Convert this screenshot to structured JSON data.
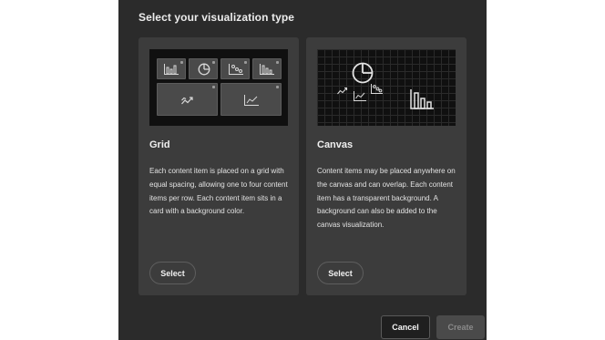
{
  "dialog": {
    "title": "Select your visualization type",
    "cancel_label": "Cancel",
    "create_label": "Create",
    "create_enabled": false
  },
  "cards": {
    "grid": {
      "title": "Grid",
      "description": "Each content item is placed on a grid with equal spacing, allowing one to four content items per row. Each content item sits in a card with a background color.",
      "select_label": "Select",
      "preview_icons": [
        "bar-chart-icon",
        "pie-chart-icon",
        "scatter-chart-icon",
        "bar-chart-icon",
        "trend-chart-icon",
        "line-chart-icon"
      ]
    },
    "canvas": {
      "title": "Canvas",
      "description": "Content items may be placed anywhere on the canvas and can overlap. Each content item has a transparent background. A background can also be added to the canvas visualization.",
      "select_label": "Select",
      "preview_icons": [
        "pie-chart-icon",
        "trend-chart-icon",
        "line-chart-icon",
        "scatter-chart-icon",
        "bar-chart-icon"
      ]
    }
  }
}
